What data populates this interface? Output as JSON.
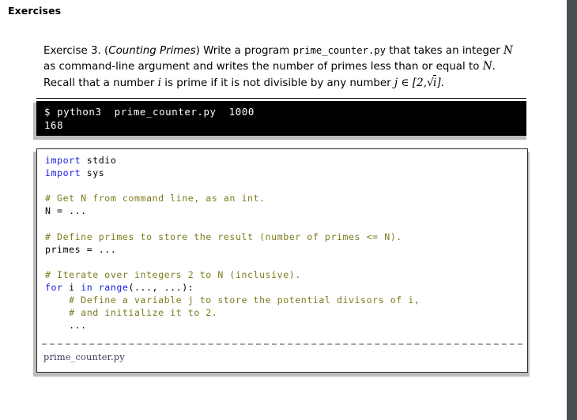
{
  "header": {
    "title": "Exercises"
  },
  "exercise": {
    "label": "Exercise 3.",
    "title_open": "(",
    "title": "Counting Primes",
    "title_close": ")",
    "text_1": "Write a program",
    "filename_inline": "prime_counter.py",
    "text_2": "that takes an integer",
    "var_n_1": "N",
    "text_3": "as command-line argument and writes the number of primes less than or equal to",
    "var_n_2": "N",
    "text_4": ". Recall that a number",
    "var_i": "i",
    "text_5": "is prime if it is not divisible by any number",
    "var_j": "j",
    "math_in": "∈",
    "math_interval_open": "[2,",
    "math_sqrt_sym": "√",
    "math_sqrt_arg": "i",
    "math_interval_close": "].",
    "full_text": "Exercise 3. (Counting Primes) Write a program prime_counter.py that takes an integer N as command-line argument and writes the number of primes less than or equal to N. Recall that a number i is prime if it is not divisible by any number j ∈ [2, √i]."
  },
  "console": {
    "prompt": "$",
    "command": "python3  prime_counter.py  1000",
    "command_full": "$ python3  prime_counter.py  1000",
    "output": "168"
  },
  "code": {
    "filename": "prime_counter.py",
    "language": "python",
    "lines": [
      [
        {
          "t": "import",
          "c": "kw"
        },
        {
          "t": " stdio",
          "c": "pl"
        }
      ],
      [
        {
          "t": "import",
          "c": "kw"
        },
        {
          "t": " sys",
          "c": "pl"
        }
      ],
      [],
      [
        {
          "t": "# Get N from command line, as an int.",
          "c": "cm"
        }
      ],
      [
        {
          "t": "N = ...",
          "c": "pl"
        }
      ],
      [],
      [
        {
          "t": "# Define primes to store the result (number of primes <= N).",
          "c": "cm"
        }
      ],
      [
        {
          "t": "primes = ...",
          "c": "pl"
        }
      ],
      [],
      [
        {
          "t": "# Iterate over integers 2 to N (inclusive).",
          "c": "cm"
        }
      ],
      [
        {
          "t": "for",
          "c": "kw"
        },
        {
          "t": " i ",
          "c": "pl"
        },
        {
          "t": "in",
          "c": "kw"
        },
        {
          "t": " ",
          "c": "pl"
        },
        {
          "t": "range",
          "c": "bi"
        },
        {
          "t": "(..., ...):",
          "c": "pl"
        }
      ],
      [
        {
          "t": "    # Define a variable j to store the potential divisors of i,",
          "c": "cm"
        }
      ],
      [
        {
          "t": "    # and initialize it to 2.",
          "c": "cm"
        }
      ],
      [
        {
          "t": "    ...",
          "c": "pl"
        }
      ]
    ],
    "plain_text": "import stdio\nimport sys\n\n# Get N from command line, as an int.\nN = ...\n\n# Define primes to store the result (number of primes <= N).\nprimes = ...\n\n# Iterate over integers 2 to N (inclusive).\nfor i in range(..., ...):\n    # Define a variable j to store the potential divisors of i,\n    # and initialize it to 2.\n    ..."
  },
  "colors": {
    "page_edge": "#4a4f52",
    "console_bg": "#000000",
    "console_fg": "#ffffff",
    "shadow": "#bcbcbc",
    "keyword": "#1a1ae6",
    "comment": "#7c7c1e",
    "code_border": "#2b2b2b",
    "divider": "#a6a6a6",
    "filename": "#3c3c5a"
  }
}
